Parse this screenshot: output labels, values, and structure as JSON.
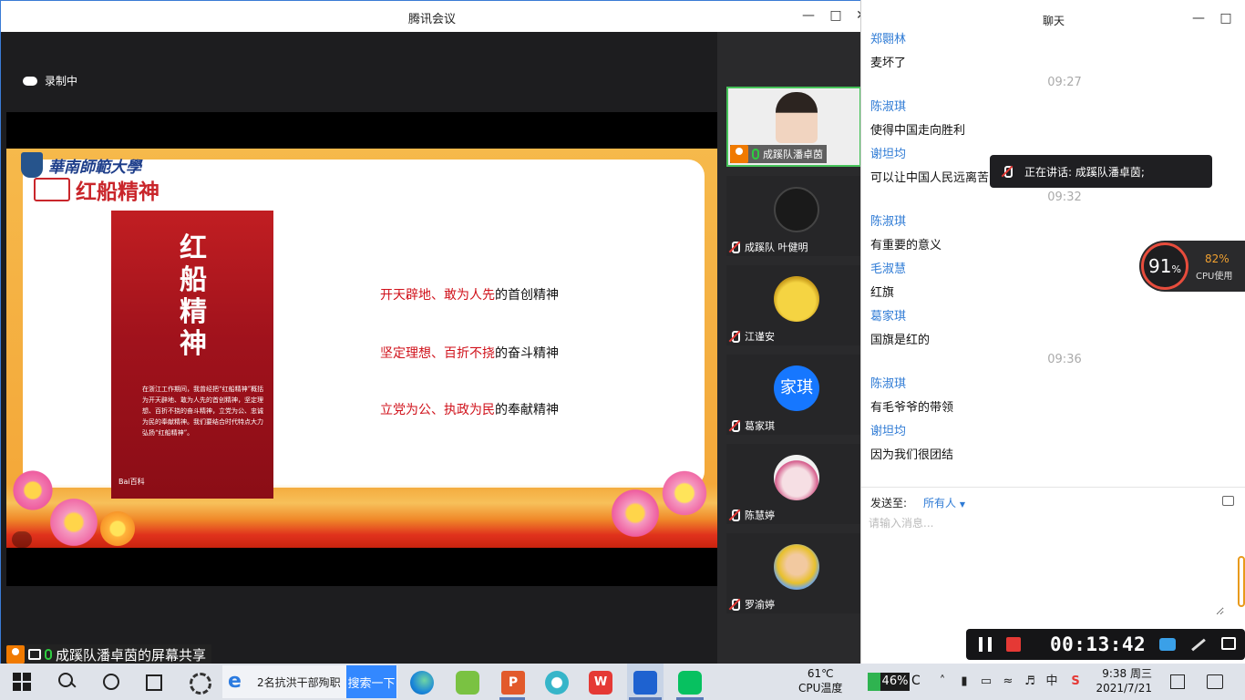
{
  "meeting": {
    "title": "腾讯会议",
    "recording_text": "录制中",
    "sharer_label": "成蹊队潘卓茵的屏幕共享"
  },
  "slide": {
    "university": "華南師範大學",
    "title": "红船精神",
    "poster_title": "红船精神",
    "poster_body": "在浙江工作期间，我曾经把“红船精神”概括为开天辟地、敢为人先的首创精神，坚定理想、百折不挠的奋斗精神，立党为公、忠诚为民的奉献精神。我们要结合时代特点大力弘扬“红船精神”。",
    "poster_brand": "Bai百科",
    "spirits": [
      {
        "red": "开天辟地、敢为人先",
        "black": "的首创精神"
      },
      {
        "red": "坚定理想、百折不挠",
        "black": "的奋斗精神"
      },
      {
        "red": "立党为公、执政为民",
        "black": "的奉献精神"
      }
    ]
  },
  "participants": [
    {
      "name": "成蹊队潘卓茵",
      "active": true,
      "muted": false
    },
    {
      "name": "成蹊队 叶健明",
      "active": false,
      "muted": true
    },
    {
      "name": "江谨安",
      "active": false,
      "muted": true
    },
    {
      "name": "葛家琪",
      "active": false,
      "muted": true,
      "avatar_text": "家琪"
    },
    {
      "name": "陈慧婷",
      "active": false,
      "muted": true
    },
    {
      "name": "罗渝婷",
      "active": false,
      "muted": true
    }
  ],
  "chat": {
    "title": "聊天",
    "messages": [
      {
        "type": "sender",
        "text": "郑翾林"
      },
      {
        "type": "text",
        "text": "麦坏了"
      },
      {
        "type": "time",
        "text": "09:27"
      },
      {
        "type": "sender",
        "text": "陈淑琪"
      },
      {
        "type": "text",
        "text": "使得中国走向胜利"
      },
      {
        "type": "sender",
        "text": "谢坦均"
      },
      {
        "type": "text",
        "text": "可以让中国人民远离苦"
      },
      {
        "type": "time",
        "text": "09:32"
      },
      {
        "type": "sender",
        "text": "陈淑琪"
      },
      {
        "type": "text",
        "text": "有重要的意义"
      },
      {
        "type": "sender",
        "text": "毛淑慧"
      },
      {
        "type": "text",
        "text": "红旗"
      },
      {
        "type": "sender",
        "text": "葛家琪"
      },
      {
        "type": "text",
        "text": "国旗是红的"
      },
      {
        "type": "time",
        "text": "09:36"
      },
      {
        "type": "sender",
        "text": "陈淑琪"
      },
      {
        "type": "text",
        "text": "有毛爷爷的带领"
      },
      {
        "type": "sender",
        "text": "谢坦均"
      },
      {
        "type": "text",
        "text": "因为我们很团结"
      }
    ],
    "send_to_label": "发送至:",
    "send_to_value": "所有人",
    "input_placeholder": "请输入消息..."
  },
  "speaking_toast": "正在讲话: 成蹊队潘卓茵;",
  "cpu_widget": {
    "gauge_value": "91",
    "gauge_unit": "%",
    "usage_value": "82%",
    "usage_label": "CPU使用"
  },
  "recording_bar": {
    "timer": "00:13:42"
  },
  "taskbar": {
    "ie_text": "2名抗洪干部殉职",
    "search_button": "搜索一下",
    "ppt_letter": "P",
    "wps_letter": "W",
    "cpu_temp_value": "61℃",
    "cpu_temp_label": "CPU温度",
    "battery": "46%",
    "battery_suffix": "C",
    "ime_label": "中",
    "time": "9:38 周三",
    "date": "2021/7/21"
  },
  "colors": {
    "accent": "#2f7bd5",
    "slide_red": "#c9262b",
    "recording_red": "#e53935"
  }
}
